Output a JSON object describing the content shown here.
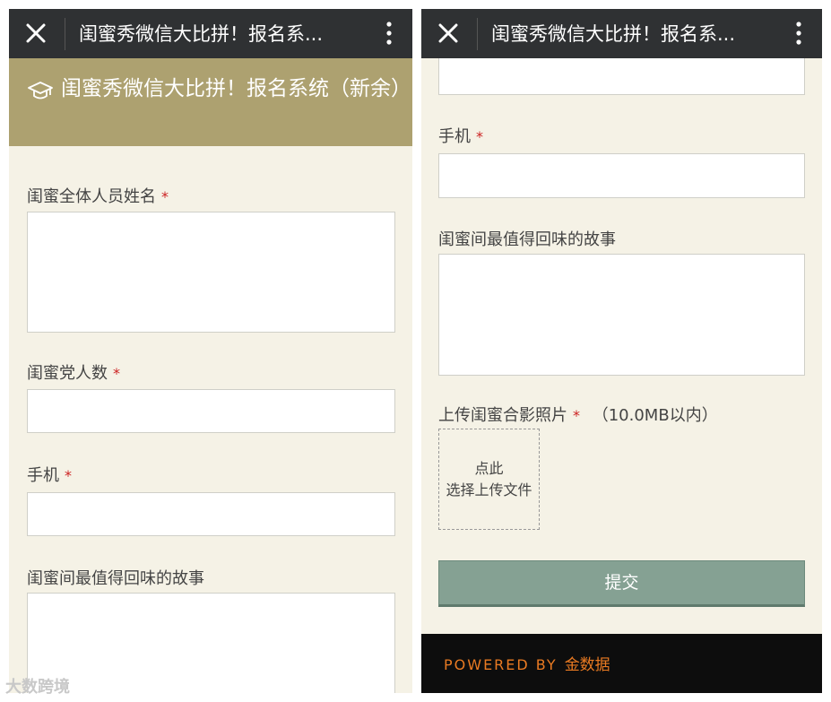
{
  "appbar": {
    "title": "闺蜜秀微信大比拼！报名系..."
  },
  "banner": {
    "title": "闺蜜秀微信大比拼！报名系统（新余）"
  },
  "form": {
    "required_mark": "*",
    "fields": {
      "names_label": "闺蜜全体人员姓名",
      "count_label": "闺蜜党人数",
      "phone_label": "手机",
      "story_label": "闺蜜间最值得回味的故事",
      "photo_label": "上传闺蜜合影照片",
      "photo_hint": "（10.0MB以内）"
    },
    "upload_box": {
      "line1": "点此",
      "line2": "选择上传文件"
    },
    "submit_label": "提交"
  },
  "footer": {
    "powered_by": "POWERED BY",
    "brand": "金数据"
  },
  "watermark": "大数跨境",
  "colors": {
    "appbar": "#2f3133",
    "banner": "#ada170",
    "page_bg": "#f5f2e6",
    "required": "#cc2222",
    "submit": "#85a193",
    "footer_text": "#e97a22"
  },
  "icons": [
    "close-icon",
    "more-vert-icon",
    "graduation-cap-icon"
  ]
}
